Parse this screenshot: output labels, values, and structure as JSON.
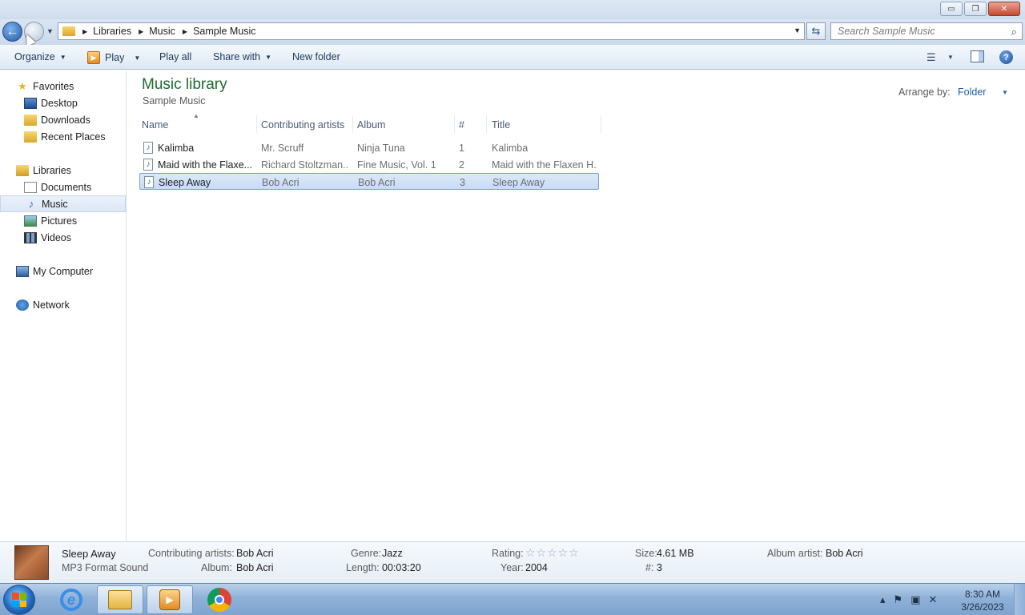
{
  "window": {
    "minimize_glyph": "▭",
    "maximize_glyph": "❐",
    "close_glyph": "✕"
  },
  "address": {
    "crumbs": [
      "Libraries",
      "Music",
      "Sample Music"
    ],
    "search_placeholder": "Search Sample Music"
  },
  "toolbar": {
    "organize": "Organize",
    "play": "Play",
    "play_all": "Play all",
    "share_with": "Share with",
    "new_folder": "New folder"
  },
  "nav": {
    "favorites": "Favorites",
    "desktop": "Desktop",
    "downloads": "Downloads",
    "recent_places": "Recent Places",
    "libraries": "Libraries",
    "documents": "Documents",
    "music": "Music",
    "pictures": "Pictures",
    "videos": "Videos",
    "my_computer": "My Computer",
    "network": "Network"
  },
  "content": {
    "library_title": "Music library",
    "library_subtitle": "Sample Music",
    "arrange_label": "Arrange by:",
    "arrange_value": "Folder",
    "columns": {
      "name": "Name",
      "artists": "Contributing artists",
      "album": "Album",
      "track": "#",
      "title": "Title"
    },
    "files": [
      {
        "name": "Kalimba",
        "artists": "Mr. Scruff",
        "album": "Ninja Tuna",
        "track": "1",
        "title": "Kalimba"
      },
      {
        "name": "Maid with the Flaxe...",
        "artists": "Richard Stoltzman...",
        "album": "Fine Music, Vol. 1",
        "track": "2",
        "title": "Maid with the Flaxen H..."
      },
      {
        "name": "Sleep Away",
        "artists": "Bob Acri",
        "album": "Bob Acri",
        "track": "3",
        "title": "Sleep Away"
      }
    ]
  },
  "details": {
    "title": "Sleep Away",
    "type": "MP3 Format Sound",
    "contributing_artists_label": "Contributing artists:",
    "contributing_artists": "Bob Acri",
    "album_label": "Album:",
    "album": "Bob Acri",
    "genre_label": "Genre:",
    "genre": "Jazz",
    "length_label": "Length:",
    "length": "00:03:20",
    "rating_label": "Rating:",
    "rating_stars": "☆☆☆☆☆",
    "year_label": "Year:",
    "year": "2004",
    "size_label": "Size:",
    "size": "4.61 MB",
    "track_label": "#:",
    "track": "3",
    "album_artist_label": "Album artist:",
    "album_artist": "Bob Acri"
  },
  "taskbar": {
    "time": "8:30 AM",
    "date": "3/26/2023",
    "tray_icons": [
      "show-hidden-icons",
      "action-center-flag-icon",
      "network-icon",
      "volume-muted-icon"
    ]
  }
}
